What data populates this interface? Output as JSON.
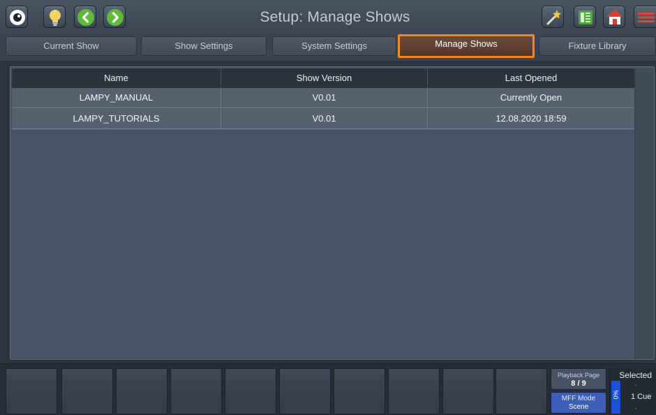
{
  "header": {
    "title": "Setup: Manage Shows",
    "left_icons": [
      "eye-icon",
      "lightbulb-icon",
      "chevron-left-icon",
      "chevron-right-icon"
    ],
    "right_icons": [
      "magic-wand-icon",
      "grid-view-icon",
      "home-icon",
      "menu-icon"
    ]
  },
  "tabs": [
    {
      "label": "Current Show",
      "active": false
    },
    {
      "label": "Show Settings",
      "active": false
    },
    {
      "label": "System Settings",
      "active": false
    },
    {
      "label": "Manage Shows",
      "active": true
    },
    {
      "label": "Fixture Library",
      "active": false
    }
  ],
  "table": {
    "columns": [
      "Name",
      "Show Version",
      "Last Opened"
    ],
    "rows": [
      [
        "LAMPY_MANUAL",
        "V0.01",
        "Currently Open"
      ],
      [
        "LAMPY_TUTORIALS",
        "V0.01",
        "12.08.2020 18:59"
      ]
    ]
  },
  "bottom": {
    "playback_page_label": "Playback Page",
    "playback_page_value": "8 / 9",
    "mff_mode_label": "MFF Mode",
    "mff_mode_value": "Scene",
    "selected_label": "Selected",
    "selected_top": "-",
    "selected_cue": "1 Cue",
    "selected_bottom": "-",
    "level_label": "0%"
  },
  "colors": {
    "active_tab_outline": "#f08a1c",
    "active_tab_bg": "#5e3f31",
    "mff_button": "#3e5fb8",
    "level_bar": "#1d50d8"
  }
}
